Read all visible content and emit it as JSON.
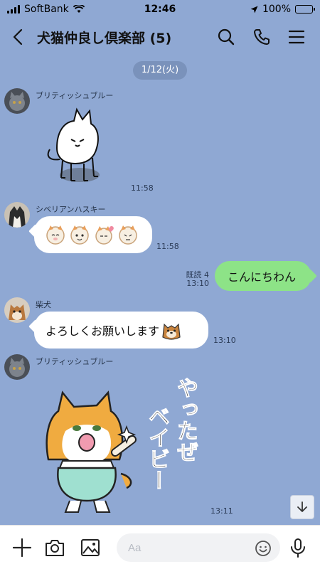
{
  "status_bar": {
    "carrier": "SoftBank",
    "time": "12:46",
    "battery": "100%",
    "battery_level": 1.0
  },
  "header": {
    "title": "犬猫仲良し倶楽部 (5)",
    "icons": [
      "back-arrow-icon",
      "search-icon",
      "phone-icon",
      "menu-icon"
    ]
  },
  "chat": {
    "date_label": "1/12(火)",
    "messages": [
      {
        "sender": "ブリティッシュブルー",
        "type": "sticker",
        "sticker": "white-cat-sitting",
        "time": "11:58"
      },
      {
        "sender": "シベリアンハスキー",
        "type": "emoji",
        "emoji": "four-shiba-faces",
        "time": "11:58"
      },
      {
        "sender": "me",
        "type": "text",
        "text": "こんにちわん",
        "read": "既読 4",
        "time": "13:10"
      },
      {
        "sender": "柴犬",
        "type": "text",
        "text": "よろしくお願いします",
        "emoji": "shiba-face",
        "time": "13:10"
      },
      {
        "sender": "ブリティッシュブルー",
        "type": "sticker",
        "sticker": "cat-yattaze-baby",
        "sticker_text": [
          "やったぜ",
          "ベイビー"
        ],
        "time": "13:11"
      }
    ]
  },
  "input_bar": {
    "placeholder": "Aa",
    "icons": [
      "plus-icon",
      "camera-icon",
      "image-icon",
      "emoji-icon",
      "microphone-icon"
    ]
  },
  "colors": {
    "background": "#8fa8d3",
    "outgoing_bubble": "#8de387",
    "incoming_bubble": "#ffffff",
    "date_pill": "#7a92bb"
  }
}
